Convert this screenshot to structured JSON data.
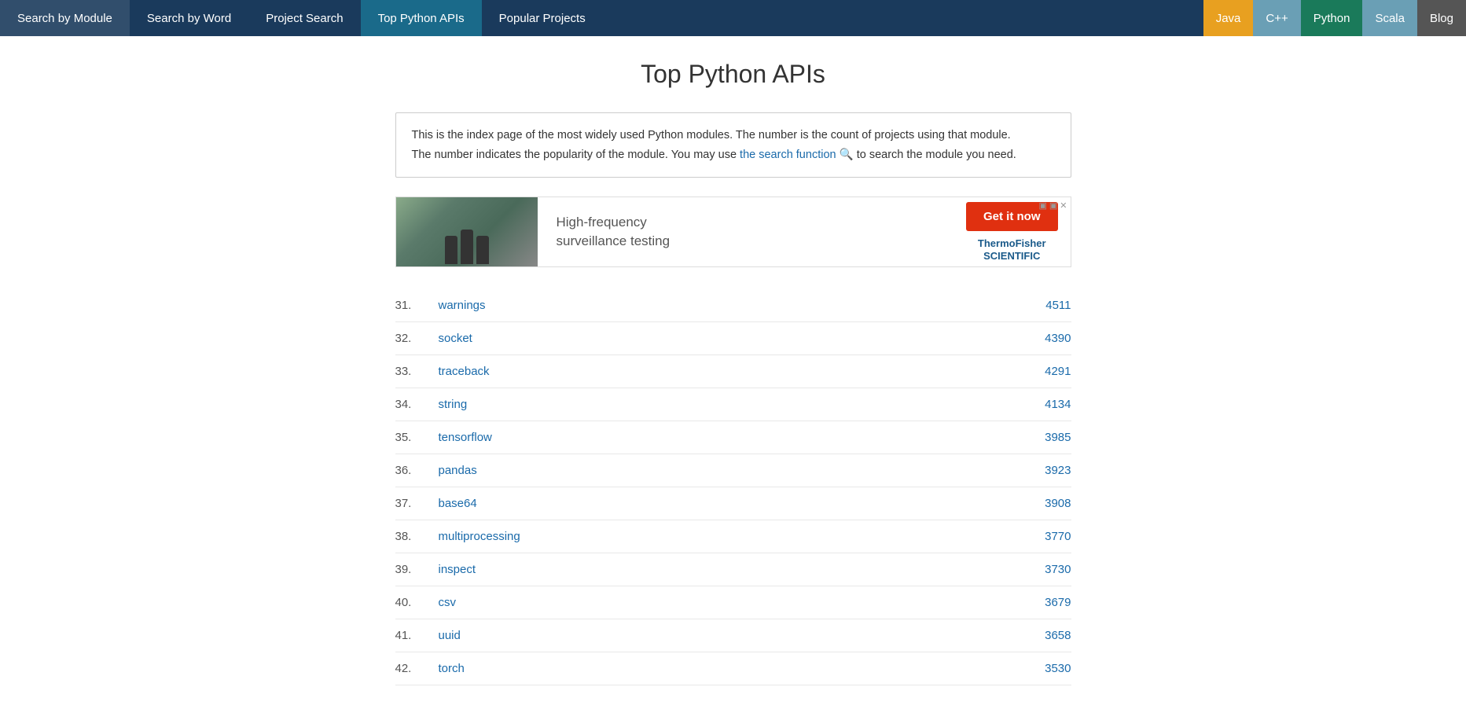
{
  "nav": {
    "items": [
      {
        "label": "Search by Module",
        "active": false
      },
      {
        "label": "Search by Word",
        "active": false
      },
      {
        "label": "Project Search",
        "active": false
      },
      {
        "label": "Top Python APIs",
        "active": true
      },
      {
        "label": "Popular Projects",
        "active": false
      }
    ],
    "lang_items": [
      {
        "label": "Java",
        "class": "java"
      },
      {
        "label": "C++",
        "class": "cpp"
      },
      {
        "label": "Python",
        "class": "python"
      },
      {
        "label": "Scala",
        "class": "scala"
      },
      {
        "label": "Blog",
        "class": "blog"
      }
    ]
  },
  "page": {
    "title": "Top Python APIs",
    "description_part1": "This is the index page of the most widely used Python modules. The number is the count of projects using that module.",
    "description_part2": "The number indicates the popularity of the module. You may use ",
    "description_link": "the search function",
    "description_part3": " to search the module you need.",
    "search_icon": "🔍"
  },
  "ad": {
    "text": "High-frequency\nsurveillance testing",
    "button_label": "Get it now",
    "brand_line1": "Thermo Fisher",
    "brand_line2": "SCIENTIFIC",
    "close_icons": "▣ ✕"
  },
  "modules": [
    {
      "number": "31.",
      "name": "warnings",
      "count": "4511"
    },
    {
      "number": "32.",
      "name": "socket",
      "count": "4390"
    },
    {
      "number": "33.",
      "name": "traceback",
      "count": "4291"
    },
    {
      "number": "34.",
      "name": "string",
      "count": "4134"
    },
    {
      "number": "35.",
      "name": "tensorflow",
      "count": "3985"
    },
    {
      "number": "36.",
      "name": "pandas",
      "count": "3923"
    },
    {
      "number": "37.",
      "name": "base64",
      "count": "3908"
    },
    {
      "number": "38.",
      "name": "multiprocessing",
      "count": "3770"
    },
    {
      "number": "39.",
      "name": "inspect",
      "count": "3730"
    },
    {
      "number": "40.",
      "name": "csv",
      "count": "3679"
    },
    {
      "number": "41.",
      "name": "uuid",
      "count": "3658"
    },
    {
      "number": "42.",
      "name": "torch",
      "count": "3530"
    }
  ]
}
